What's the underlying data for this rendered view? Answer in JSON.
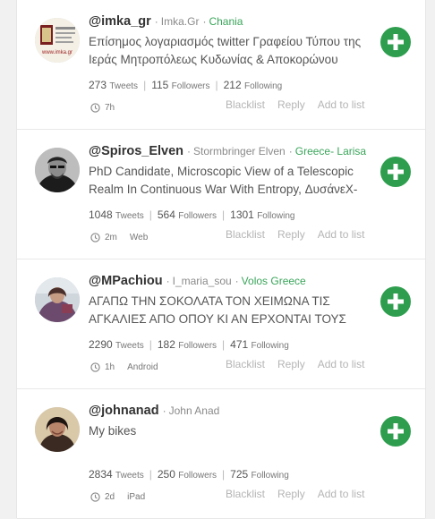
{
  "colors": {
    "accent_green": "#2e9e4e",
    "location_green": "#3aa55a",
    "muted_text": "#b5b5b5"
  },
  "icons": {
    "follow": "plus-circle-icon",
    "time": "clock-icon"
  },
  "users": [
    {
      "handle": "@imka_gr",
      "name": "Imka.Gr",
      "location": "Chania",
      "bio": "Επίσημος λογαριασμός twitter Γραφείου Τύπου της Ιεράς Μητροπόλεως Κυδωνίας & Αποκορώνου",
      "tweets": "273",
      "tweets_label": "Tweets",
      "followers": "115",
      "followers_label": "Followers",
      "following": "212",
      "following_label": "Following",
      "time": "7h",
      "client": "",
      "actions": {
        "blacklist": "Blacklist",
        "reply": "Reply",
        "add": "Add to list"
      },
      "avatar_logo_text": "www.imka.gr"
    },
    {
      "handle": "@Spiros_Elven",
      "name": "Stormbringer Elven",
      "location": "Greece- Larisa",
      "bio": "PhD Candidate, Microscopic View of a Telescopic Realm In Continuous War With Entropy, ΔυσάνεΧ-",
      "tweets": "1048",
      "tweets_label": "Tweets",
      "followers": "564",
      "followers_label": "Followers",
      "following": "1301",
      "following_label": "Following",
      "time": "2m",
      "client": "Web",
      "actions": {
        "blacklist": "Blacklist",
        "reply": "Reply",
        "add": "Add to list"
      }
    },
    {
      "handle": "@MPachiou",
      "name": "I_maria_sou",
      "location": "Volos Greece",
      "bio": "ΑΓΑΠΩ ΤΗΝ ΣΟΚΟΛΑΤΑ ΤΟΝ ΧΕΙΜΩΝΑ ΤΙΣ ΑΓΚΑΛΙΕΣ ΑΠΟ ΟΠΟΥ ΚΙ ΑΝ ΕΡΧΟΝΤΑΙ ΤΟΥΣ",
      "tweets": "2290",
      "tweets_label": "Tweets",
      "followers": "182",
      "followers_label": "Followers",
      "following": "471",
      "following_label": "Following",
      "time": "1h",
      "client": "Android",
      "actions": {
        "blacklist": "Blacklist",
        "reply": "Reply",
        "add": "Add to list"
      }
    },
    {
      "handle": "@johnanad",
      "name": "John Anad",
      "location": "",
      "bio": "My bikes",
      "tweets": "2834",
      "tweets_label": "Tweets",
      "followers": "250",
      "followers_label": "Followers",
      "following": "725",
      "following_label": "Following",
      "time": "2d",
      "client": "iPad",
      "actions": {
        "blacklist": "Blacklist",
        "reply": "Reply",
        "add": "Add to list"
      }
    }
  ]
}
